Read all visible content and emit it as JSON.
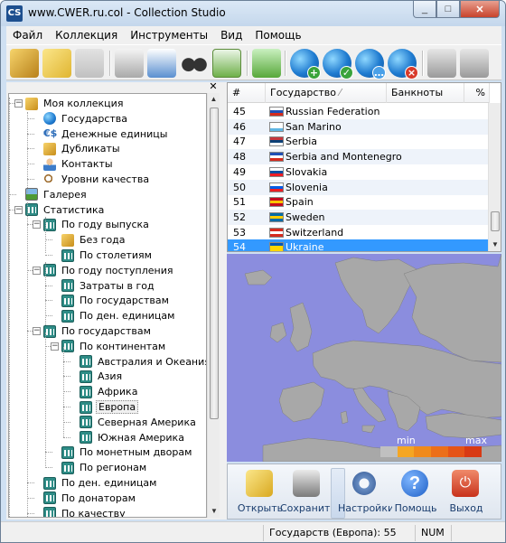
{
  "window": {
    "icon_text": "CS",
    "title": "www.CWER.ru.col - Collection Studio",
    "controls": [
      "_",
      "□",
      "✕"
    ]
  },
  "menu": [
    "Файл",
    "Коллекция",
    "Инструменты",
    "Вид",
    "Помощь"
  ],
  "toolbar": {
    "buttons": [
      "open-collection",
      "open-folder",
      "save",
      "print",
      "print-preview",
      "search",
      "chart",
      "add-item",
      "add-country",
      "edit-country",
      "comment-country",
      "delete-country",
      "import",
      "export"
    ]
  },
  "tree": {
    "close_glyph": "✕",
    "items": [
      {
        "label": "Моя коллекция",
        "expander": "−",
        "icon": "book-icon"
      },
      {
        "label": "Государства",
        "icon": "globe-icon"
      },
      {
        "label": "Денежные единицы",
        "icon": "currency-icon",
        "icon_text": "€$"
      },
      {
        "label": "Дубликаты",
        "icon": "book-icon"
      },
      {
        "label": "Контакты",
        "icon": "person-icon"
      },
      {
        "label": "Уровни качества",
        "icon": "magnifier-icon"
      },
      {
        "label": "Галерея",
        "icon": "gallery-icon"
      },
      {
        "label": "Статистика",
        "expander": "−",
        "icon": "chart-icon"
      },
      {
        "label": "По году выпуска",
        "expander": "−",
        "icon": "chart-icon"
      },
      {
        "label": "Без года",
        "icon": "book-icon"
      },
      {
        "label": "По столетиям",
        "icon": "chart-icon"
      },
      {
        "label": "По году поступления",
        "expander": "−",
        "icon": "chart-icon"
      },
      {
        "label": "Затраты в год",
        "icon": "chart-icon"
      },
      {
        "label": "По государствам",
        "icon": "chart-icon"
      },
      {
        "label": "По ден. единицам",
        "icon": "chart-icon"
      },
      {
        "label": "По государствам",
        "expander": "−",
        "icon": "chart-icon"
      },
      {
        "label": "По континентам",
        "expander": "−",
        "icon": "chart-icon"
      },
      {
        "label": "Австралия и Океания",
        "icon": "chart-icon"
      },
      {
        "label": "Азия",
        "icon": "chart-icon"
      },
      {
        "label": "Африка",
        "icon": "chart-icon"
      },
      {
        "label": "Европа",
        "icon": "chart-icon",
        "selected": true
      },
      {
        "label": "Северная Америка",
        "icon": "chart-icon"
      },
      {
        "label": "Южная Америка",
        "icon": "chart-icon"
      },
      {
        "label": "По монетным дворам",
        "icon": "chart-icon"
      },
      {
        "label": "По регионам",
        "icon": "chart-icon"
      },
      {
        "label": "По ден. единицам",
        "icon": "chart-icon"
      },
      {
        "label": "По донаторам",
        "icon": "chart-icon"
      },
      {
        "label": "По качеству",
        "icon": "chart-icon"
      }
    ]
  },
  "table": {
    "headers": [
      "#",
      "Государство",
      "Банкноты",
      "%"
    ],
    "sort_indicator": "⁄",
    "rows": [
      {
        "num": "45",
        "name": "Russian Federation",
        "flag": [
          "#ffffff",
          "#1f4fb5",
          "#d52b1e"
        ]
      },
      {
        "num": "46",
        "name": "San Marino",
        "flag": [
          "#ffffff",
          "#ffffff",
          "#5eb6e4"
        ]
      },
      {
        "num": "47",
        "name": "Serbia",
        "flag": [
          "#c6363c",
          "#0c4076",
          "#ffffff"
        ]
      },
      {
        "num": "48",
        "name": "Serbia and Montenegro",
        "flag": [
          "#1f4fb5",
          "#ffffff",
          "#d52b1e"
        ]
      },
      {
        "num": "49",
        "name": "Slovakia",
        "flag": [
          "#ffffff",
          "#0b4ea2",
          "#ee1c25"
        ]
      },
      {
        "num": "50",
        "name": "Slovenia",
        "flag": [
          "#ffffff",
          "#005ce6",
          "#ed1c24"
        ]
      },
      {
        "num": "51",
        "name": "Spain",
        "flag": [
          "#c60b1e",
          "#ffc400",
          "#c60b1e"
        ]
      },
      {
        "num": "52",
        "name": "Sweden",
        "flag": [
          "#006aa7",
          "#fecc00",
          "#006aa7"
        ]
      },
      {
        "num": "53",
        "name": "Switzerland",
        "flag": [
          "#d52b1e",
          "#ffffff",
          "#d52b1e"
        ]
      },
      {
        "num": "54",
        "name": "Ukraine",
        "flag": [
          "#0057b7",
          "#ffd700",
          "#ffd700"
        ],
        "selected": true
      }
    ]
  },
  "map": {
    "ocean_color": "#8b8dde",
    "land_color": "#a8a8a8",
    "legend_min": "min",
    "legend_max": "max",
    "legend_colors": [
      "#c0c0c0",
      "#f5a623",
      "#f08a1c",
      "#ec6f1a",
      "#e55418",
      "#d83a14"
    ]
  },
  "actions": [
    {
      "label": "Открыть",
      "icon": "open-folder-icon"
    },
    {
      "label": "Сохранить",
      "icon": "save-disk-icon"
    },
    {
      "label": "Настройки",
      "icon": "settings-gear-icon"
    },
    {
      "label": "Помощь",
      "icon": "help-icon",
      "icon_text": "?"
    },
    {
      "label": "Выход",
      "icon": "exit-icon",
      "icon_text": "⏻"
    }
  ],
  "status": {
    "message": "Государств (Европа): 55",
    "num": "NUM"
  }
}
